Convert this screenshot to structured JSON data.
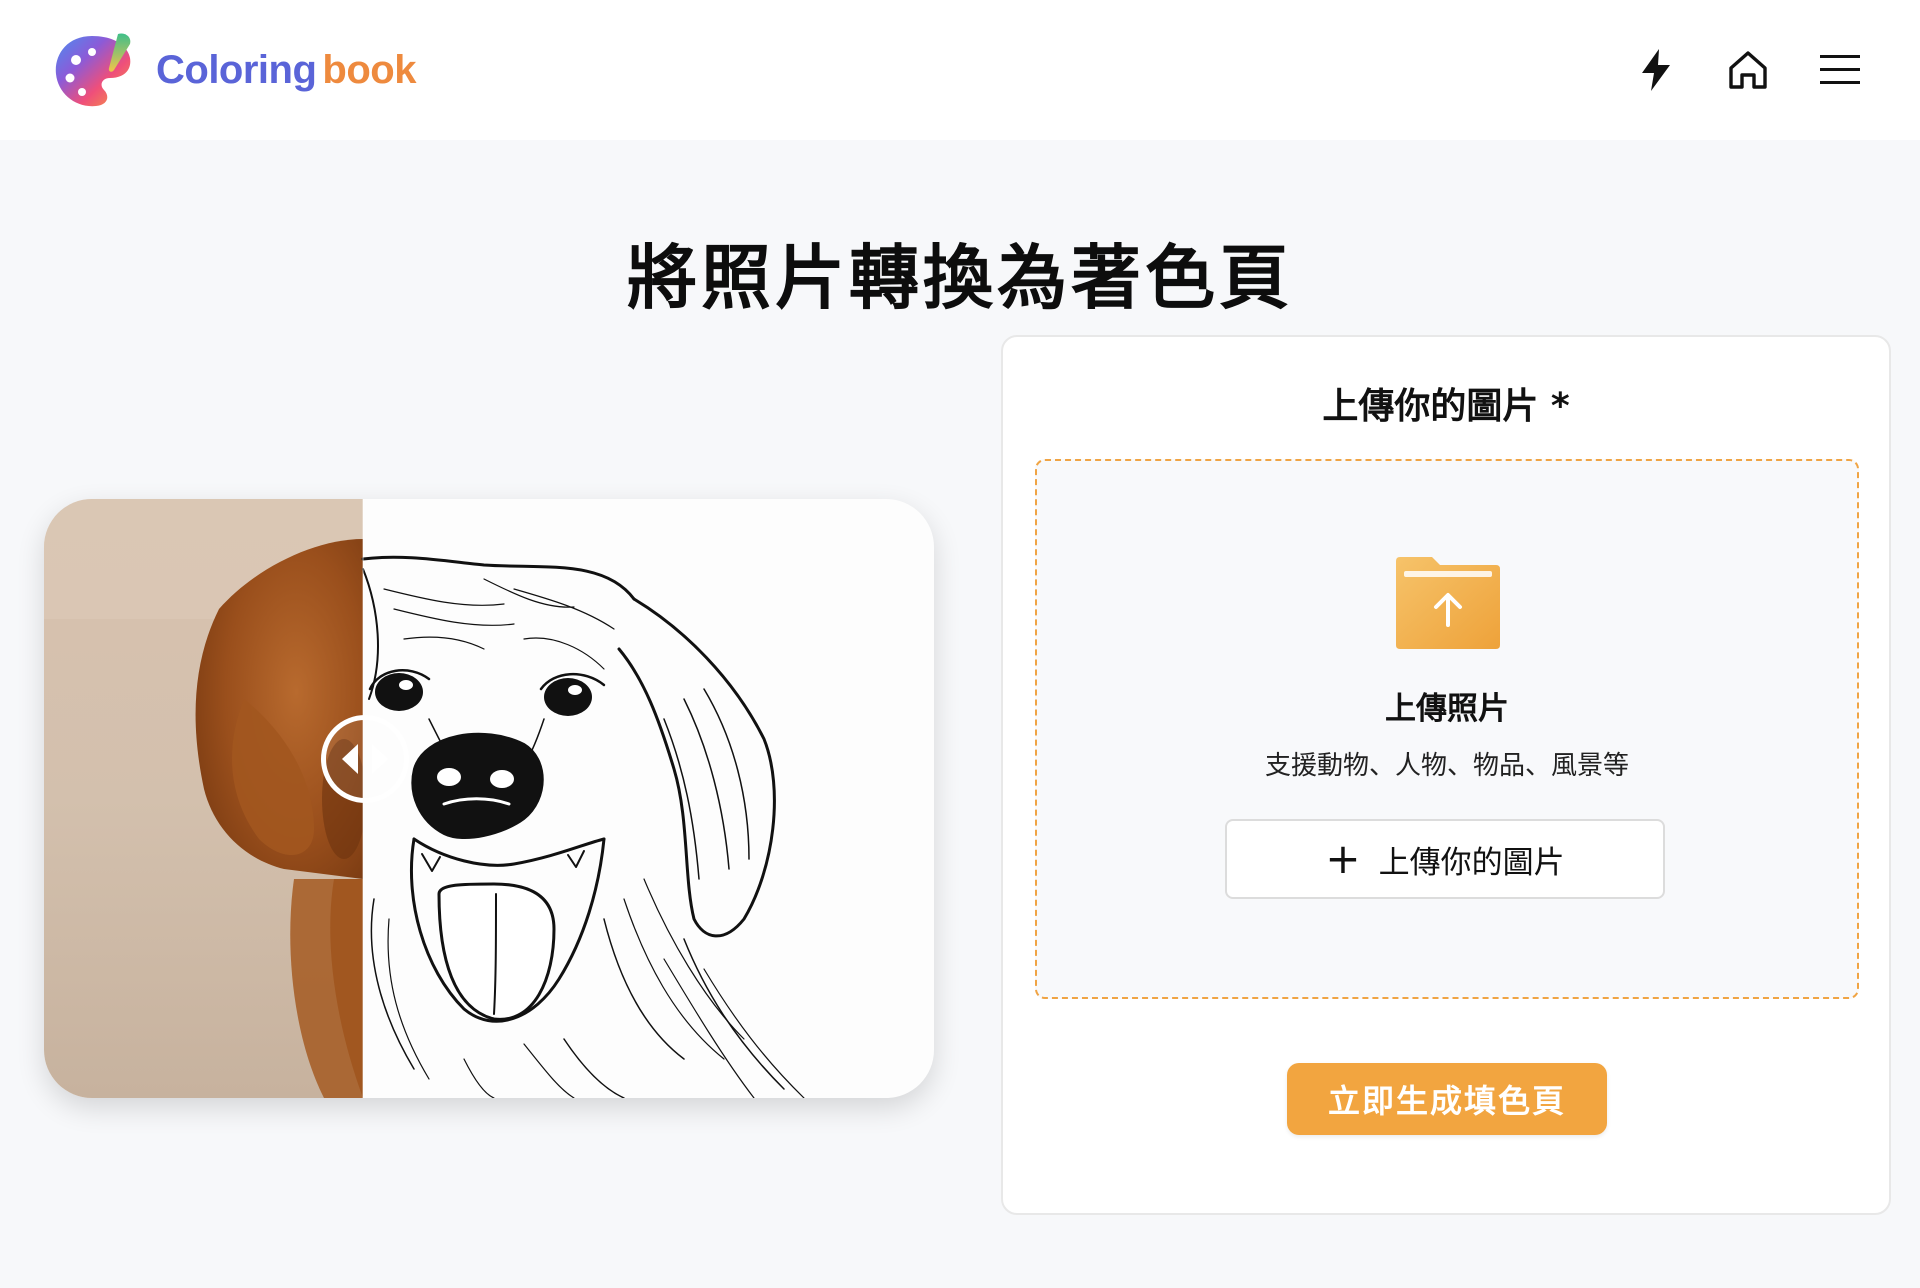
{
  "brand": {
    "name_part1": "Coloring",
    "name_part2": "book",
    "colors": {
      "primary": "#5a64d8",
      "accent": "#ee8a3e"
    }
  },
  "nav": {
    "icons": [
      "lightning-icon",
      "home-icon",
      "menu-icon"
    ]
  },
  "page_title": "將照片轉換為著色頁",
  "compare": {
    "before_label": "photo",
    "after_label": "coloring-page",
    "handle_icon": "compare-arrows-icon",
    "split_fraction": 0.36
  },
  "upload": {
    "title": "上傳你的圖片 *",
    "dropzone_title": "上傳照片",
    "dropzone_subtitle": "支援動物、人物、物品、風景等",
    "upload_button_label": "上傳你的圖片",
    "generate_button_label": "立即生成填色頁",
    "accent_color": "#f2a540"
  }
}
